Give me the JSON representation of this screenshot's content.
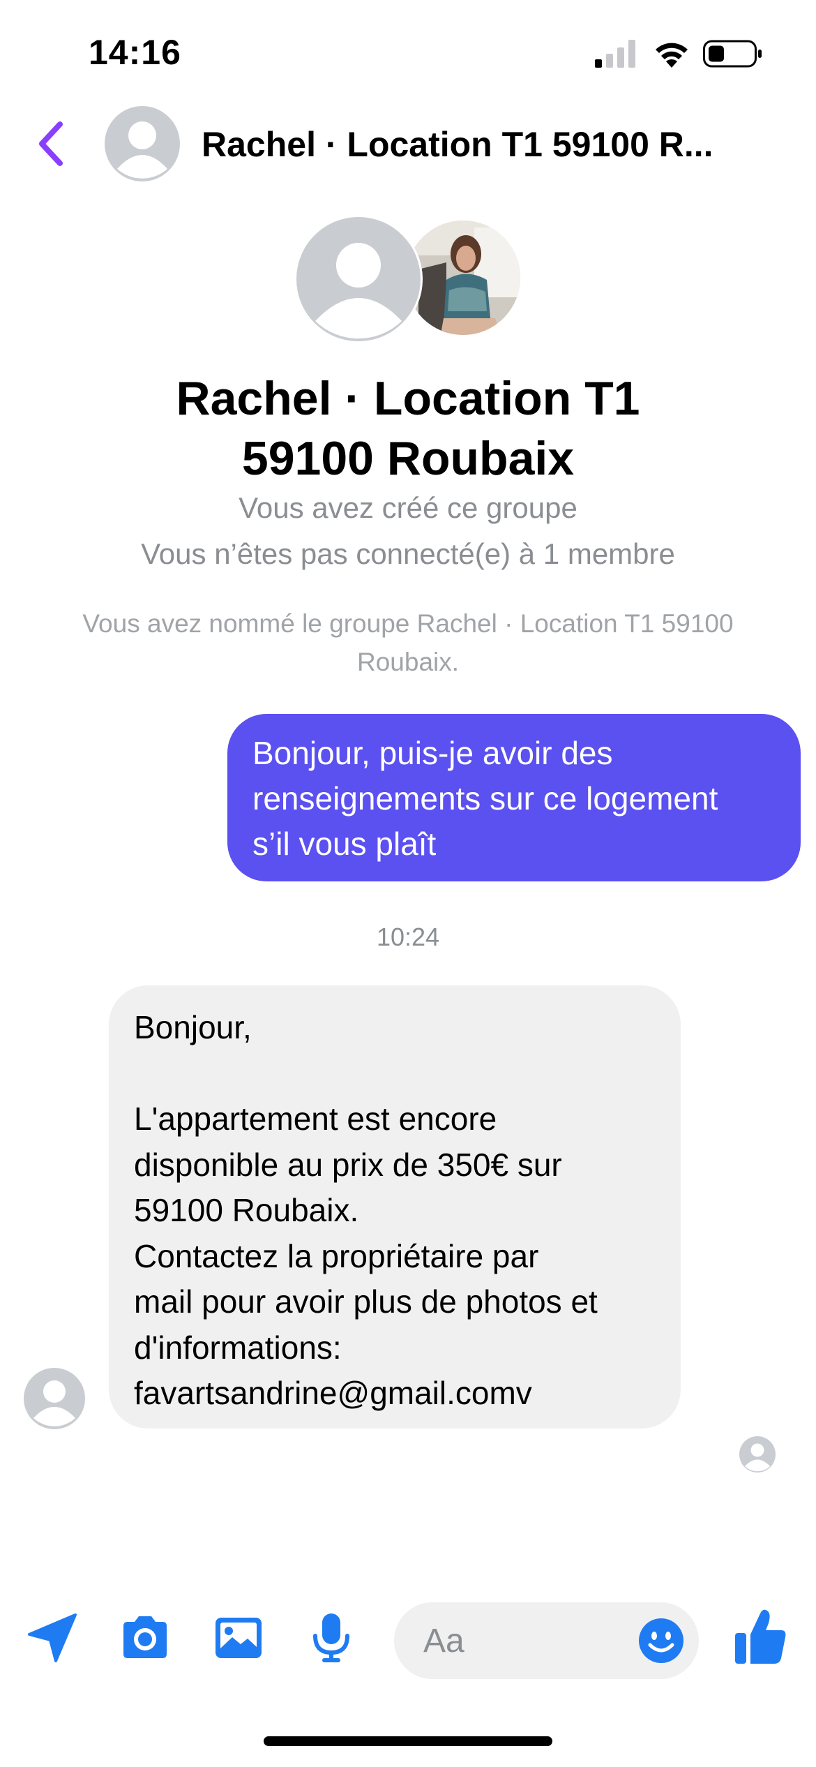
{
  "status_bar": {
    "time": "14:16"
  },
  "header": {
    "title": "Rachel · Location T1 59100 R..."
  },
  "group_info": {
    "title_line1": "Rachel · Location T1",
    "title_line2": "59100 Roubaix",
    "created_text": "Vous avez créé ce groupe",
    "connection_text": "Vous n’êtes pas connecté(e) à 1 membre",
    "rename_line1": "Vous avez nommé le groupe Rachel · Location T1 59100",
    "rename_line2": "Roubaix."
  },
  "messages": [
    {
      "direction": "sent",
      "lines": [
        "Bonjour, puis-je avoir des",
        "renseignements sur ce logement",
        "s’il vous plaît"
      ]
    },
    {
      "direction": "timestamp",
      "text": "10:24"
    },
    {
      "direction": "received",
      "lines": [
        "Bonjour,",
        "",
        "L'appartement est encore",
        "disponible au prix de 350€ sur",
        "59100 Roubaix.",
        "Contactez la propriétaire par",
        "mail pour avoir plus de photos et",
        "d'informations:",
        "favartsandrine@gmail.comv"
      ]
    }
  ],
  "composer": {
    "placeholder": "Aa"
  },
  "icons": {
    "back": "chevron-left-icon",
    "location": "location-arrow-icon",
    "camera": "camera-icon",
    "gallery": "image-icon",
    "microphone": "microphone-icon",
    "emoji": "smiley-icon",
    "like": "thumbs-up-icon"
  },
  "colors": {
    "accent_blue": "#1f7bf2",
    "back_purple": "#8a3ffc",
    "sent_bubble": "#5b50f0",
    "received_bubble": "#f0f0f0"
  }
}
